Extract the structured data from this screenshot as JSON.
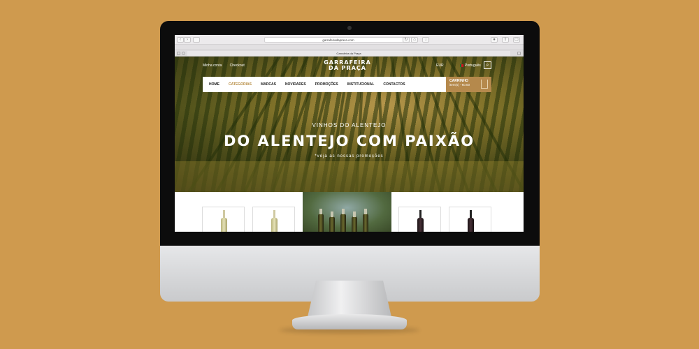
{
  "browser": {
    "url": "garrafeiradapraca.com",
    "tab_title": "Garrafeira da Praça"
  },
  "header": {
    "top_links": [
      "Minha conta",
      "Checkout"
    ],
    "logo_line1": "GARRAFEIRA",
    "logo_line2": "DA PRAÇA",
    "currency": "EUR",
    "language": "Português"
  },
  "nav": {
    "items": [
      "HOME",
      "CATEGORIAS",
      "MARCAS",
      "NOVIDADES",
      "PROMOÇÕES",
      "INSTITUCIONAL",
      "CONTACTOS"
    ],
    "active": "CATEGORIAS"
  },
  "cart": {
    "title": "CARRINHO",
    "summary": "item(s) - €0.00"
  },
  "hero": {
    "subtitle": "VINHOS DO ALENTEJO",
    "title": "DO ALENTEJO COM PAIXÃO",
    "note": "*veja as nossas promoções"
  },
  "colors": {
    "background": "#cf9a4e",
    "accent": "#b5894c"
  }
}
